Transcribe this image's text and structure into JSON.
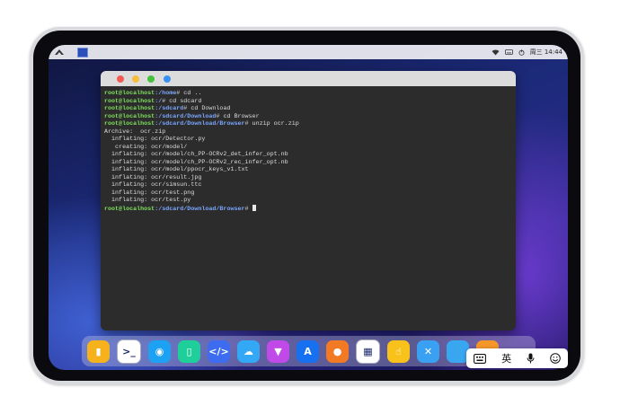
{
  "statusbar": {
    "clock": "周三 14:44"
  },
  "terminal": {
    "lines": [
      {
        "user": "root@localhost",
        "path": ":/home",
        "cmd": "# cd .."
      },
      {
        "user": "root@localhost",
        "path": ":/",
        "cmd": "# cd sdcard"
      },
      {
        "user": "root@localhost",
        "path": ":/sdcard",
        "cmd": "# cd Download"
      },
      {
        "user": "root@localhost",
        "path": ":/sdcard/Download",
        "cmd": "# cd Browser"
      },
      {
        "user": "root@localhost",
        "path": ":/sdcard/Download/Browser",
        "cmd": "# unzip ocr.zip"
      }
    ],
    "output": [
      "Archive:  ocr.zip",
      "  inflating: ocr/Detector.py",
      "   creating: ocr/model/",
      "  inflating: ocr/model/ch_PP-OCRv2_det_infer_opt.nb",
      "  inflating: ocr/model/ch_PP-OCRv2_rec_infer_opt.nb",
      "  inflating: ocr/model/ppocr_keys_v1.txt",
      "  inflating: ocr/result.jpg",
      "  inflating: ocr/simsun.ttc",
      "  inflating: ocr/test.png",
      "  inflating: ocr/test.py"
    ],
    "final_prompt": {
      "user": "root@localhost",
      "path": ":/sdcard/Download/Browser",
      "cmd": "# "
    }
  },
  "dock": {
    "apps": [
      {
        "name": "files-app-icon",
        "bg": "#f6b21c",
        "glyph": "▮"
      },
      {
        "name": "terminal-app-icon",
        "bg": "#ffffff",
        "glyph": ">_"
      },
      {
        "name": "browser-app-icon",
        "bg": "#1da1f2",
        "glyph": "◉"
      },
      {
        "name": "notes-app-icon",
        "bg": "#1fcf9a",
        "glyph": "▯"
      },
      {
        "name": "code-editor-app-icon",
        "bg": "#3d6cf0",
        "glyph": "</>"
      },
      {
        "name": "cloud-app-icon",
        "bg": "#33a9f5",
        "glyph": "☁"
      },
      {
        "name": "paint-app-icon",
        "bg": "#c04ae8",
        "glyph": "▼"
      },
      {
        "name": "app-store-app-icon",
        "bg": "#1670f0",
        "glyph": "A"
      },
      {
        "name": "tips-app-icon",
        "bg": "#f27a25",
        "glyph": "●"
      },
      {
        "name": "calculator-app-icon",
        "bg": "#ffffff",
        "glyph": "▦"
      },
      {
        "name": "gesture-app-icon",
        "bg": "#f9c21a",
        "glyph": "☝"
      },
      {
        "name": "tools-app-icon",
        "bg": "#39a0f2",
        "glyph": "✕"
      },
      {
        "name": "app-13-icon",
        "bg": "#39a7f0",
        "glyph": ""
      },
      {
        "name": "app-14-icon",
        "bg": "#f4962a",
        "glyph": ""
      }
    ]
  },
  "ime": {
    "lang_label": "英"
  }
}
